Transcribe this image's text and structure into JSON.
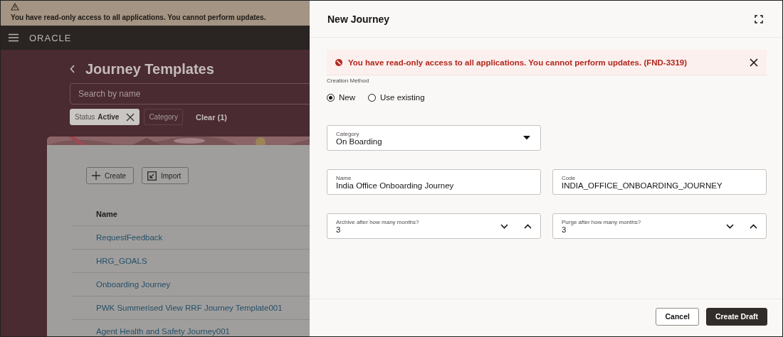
{
  "banner": {
    "text": "You have read-only access to all applications. You cannot perform updates."
  },
  "app_bar": {
    "logo": "ORACLE"
  },
  "page": {
    "title": "Journey Templates",
    "search": {
      "placeholder": "Search by name"
    },
    "filters": [
      {
        "label": "Status",
        "value": "Active",
        "selected": true
      },
      {
        "label": "Category",
        "selected": false
      }
    ],
    "clear": "Clear (1)",
    "buttons": [
      {
        "kind": "create",
        "label": "Create"
      },
      {
        "kind": "import",
        "label": "Import"
      }
    ],
    "table": {
      "columns": [
        "Name"
      ],
      "rows": [
        "RequestFeedback",
        "HRG_GOALS",
        "Onboarding Journey",
        "PWK Summerised View RRF Journey Template001",
        "Agent Health and Safety Journey001"
      ]
    }
  },
  "drawer": {
    "title": "New Journey",
    "error": "You have read-only access to all applications. You cannot perform updates. (FND-3319)",
    "creation_method": {
      "label": "Creation Method",
      "options": [
        {
          "label": "New",
          "selected": true
        },
        {
          "label": "Use existing",
          "selected": false
        }
      ]
    },
    "field_rows": [
      [
        {
          "kind": "select",
          "label": "Category",
          "value": "On Boarding"
        }
      ],
      [
        {
          "kind": "text",
          "label": "Name",
          "value": "India Office Onboarding Journey"
        },
        {
          "kind": "text",
          "label": "Code",
          "value": "INDIA_OFFICE_ONBOARDING_JOURNEY"
        }
      ],
      [
        {
          "kind": "number",
          "label": "Archive after how many months?",
          "value": "3"
        },
        {
          "kind": "number",
          "label": "Purge after how many months?",
          "value": "3"
        }
      ]
    ],
    "buttons": [
      {
        "kind": "secondary",
        "label": "Cancel"
      },
      {
        "kind": "primary",
        "label": "Create Draft"
      }
    ]
  }
}
